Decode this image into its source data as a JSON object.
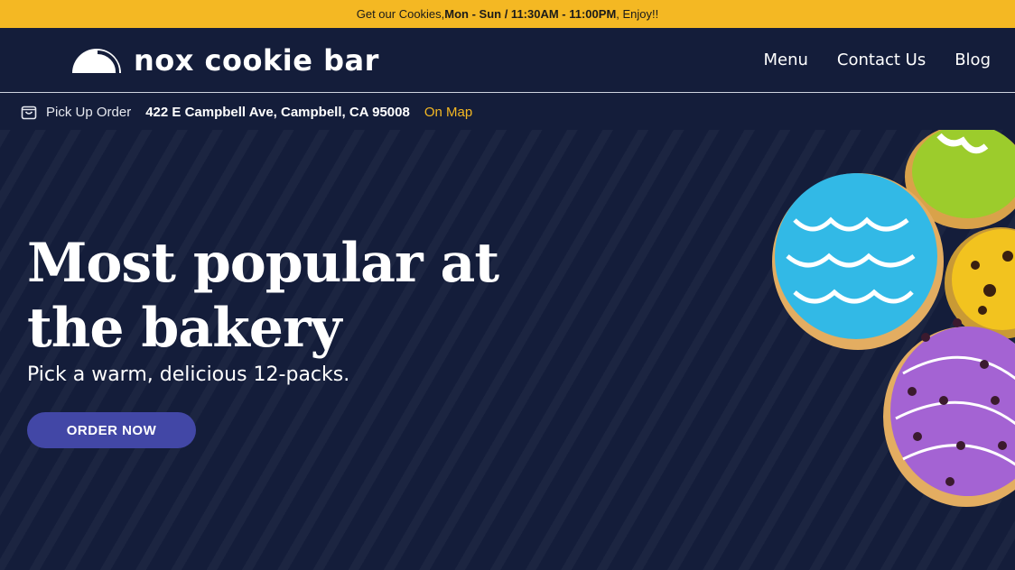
{
  "announcement": {
    "prefix": "Get our Cookies, ",
    "hours": "Mon - Sun / 11:30AM - 11:00PM",
    "suffix": ", Enjoy!!"
  },
  "brand": {
    "name": "nox cookie bar",
    "logo_icon": "half-dome-icon"
  },
  "nav": {
    "items": [
      "Menu",
      "Contact Us",
      "Blog"
    ]
  },
  "pickup": {
    "icon": "shopping-bag-icon",
    "label": "Pick Up Order",
    "address": "422 E Campbell Ave, Campbell, CA 95008",
    "map_link": "On Map"
  },
  "hero": {
    "headline_line1": "Most popular at",
    "headline_line2": "the bakery",
    "subheadline": "Pick a warm, delicious 12-packs.",
    "cta": "ORDER NOW",
    "image": "frosted-donuts"
  },
  "colors": {
    "accent_yellow": "#f4b823",
    "navy": "#141d3a",
    "button_blue": "#4247a6"
  }
}
